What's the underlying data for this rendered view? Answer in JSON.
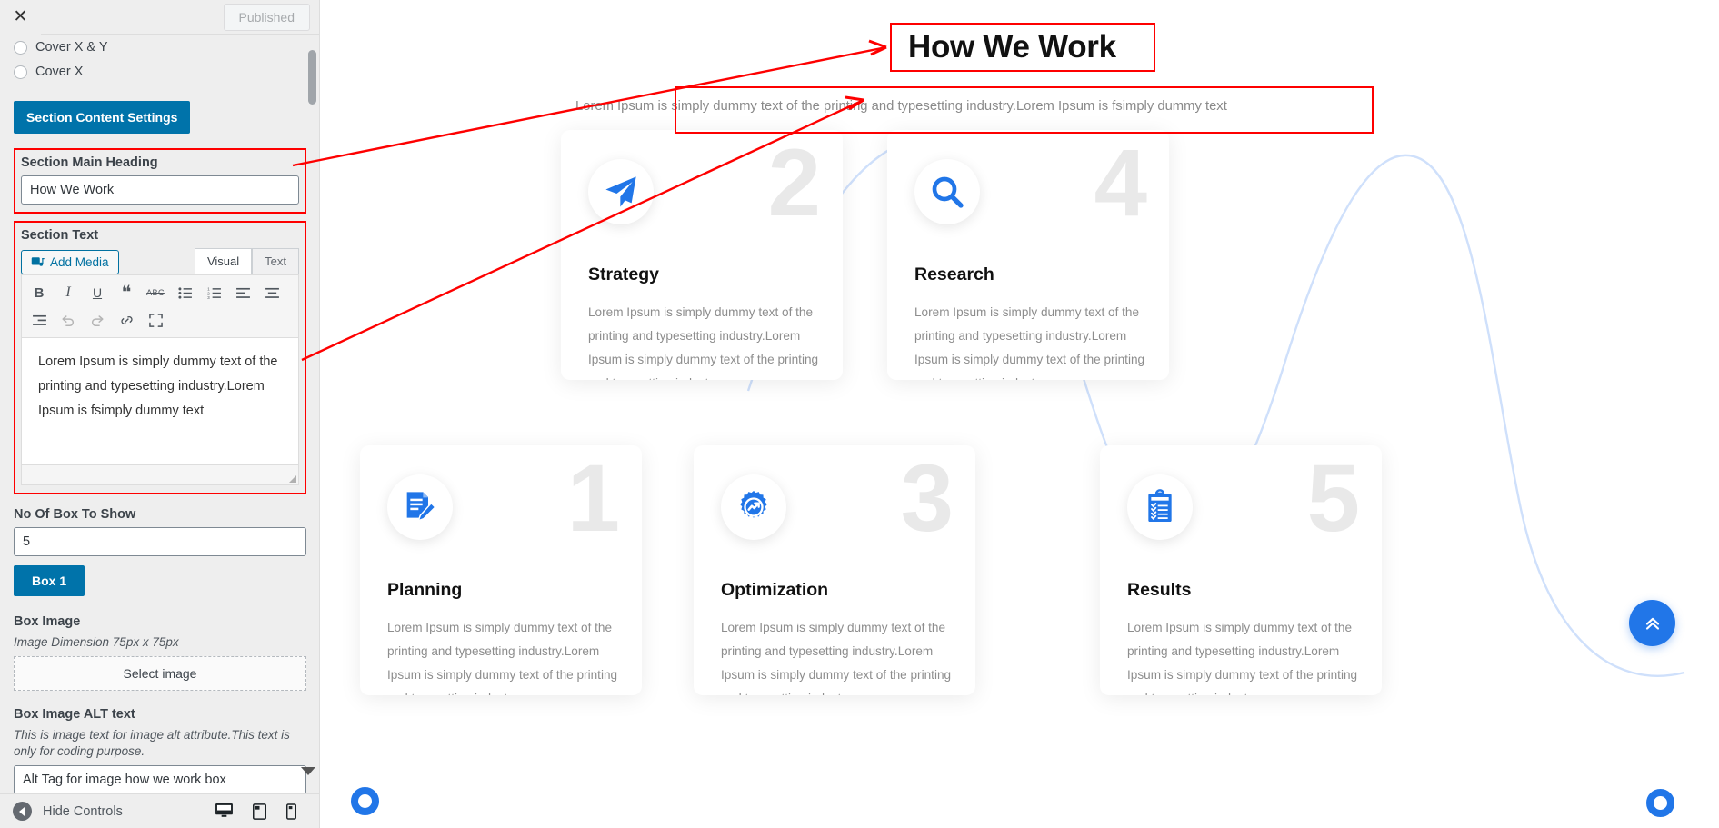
{
  "customizer": {
    "close_icon": "close-x-icon",
    "publish_label": "Published",
    "radio_options": [
      {
        "label": "Cover X & Y"
      },
      {
        "label": "Cover X"
      }
    ],
    "section_content_settings_label": "Section Content Settings",
    "main_heading": {
      "label": "Section Main Heading",
      "value": "How We Work"
    },
    "section_text": {
      "label": "Section Text",
      "add_media_label": "Add Media",
      "tabs": [
        {
          "label": "Visual",
          "active": true
        },
        {
          "label": "Text",
          "active": false
        }
      ],
      "toolbar_row1": [
        {
          "name": "bold-icon",
          "glyph": "B"
        },
        {
          "name": "italic-icon",
          "glyph": "I"
        },
        {
          "name": "underline-icon",
          "glyph": "U"
        },
        {
          "name": "blockquote-icon",
          "glyph": "“"
        },
        {
          "name": "strikethrough-icon",
          "glyph": "ABC"
        },
        {
          "name": "bulleted-list-icon",
          "glyph": "list"
        },
        {
          "name": "numbered-list-icon",
          "glyph": "numlist"
        },
        {
          "name": "align-left-icon",
          "glyph": "alignleft"
        },
        {
          "name": "align-center-icon",
          "glyph": "aligncenter"
        }
      ],
      "toolbar_row2": [
        {
          "name": "align-right-icon",
          "glyph": "alignright"
        },
        {
          "name": "undo-icon",
          "glyph": "↶"
        },
        {
          "name": "redo-icon",
          "glyph": "↷"
        },
        {
          "name": "insert-link-icon",
          "glyph": "link"
        },
        {
          "name": "fullscreen-icon",
          "glyph": "fullscreen"
        }
      ],
      "content": "Lorem Ipsum is simply dummy text of the printing and typesetting industry.Lorem Ipsum is fsimply dummy text"
    },
    "no_of_box": {
      "label": "No Of Box To Show",
      "value": "5"
    },
    "box_tab_label": "Box 1",
    "box_image": {
      "label": "Box Image",
      "help": "Image Dimension 75px x 75px",
      "select_label": "Select image"
    },
    "box_image_alt": {
      "label": "Box Image ALT text",
      "help": "This is image text for image alt attribute.This text is only for coding purpose.",
      "value": "Alt Tag for image how we work box"
    },
    "footer": {
      "collapse_label": "Hide Controls",
      "devices": [
        {
          "name": "desktop-preview-icon"
        },
        {
          "name": "tablet-preview-icon"
        },
        {
          "name": "mobile-preview-icon"
        }
      ]
    }
  },
  "preview": {
    "heading": "How We Work",
    "subtext": "Lorem Ipsum is simply dummy text of the printing and typesetting industry.Lorem Ipsum is fsimply dummy text",
    "body_text": "Lorem Ipsum is simply dummy text of the printing and typesetting industry.Lorem Ipsum is simply dummy text of the printing and typesetting industry.",
    "accent_color": "#2176e8",
    "watermark_color": "#e9e9e9",
    "cards": [
      {
        "number": "2",
        "title": "Strategy",
        "icon": "paper-plane-icon"
      },
      {
        "number": "4",
        "title": "Research",
        "icon": "magnifier-icon"
      },
      {
        "number": "1",
        "title": "Planning",
        "icon": "document-pencil-icon"
      },
      {
        "number": "3",
        "title": "Optimization",
        "icon": "gear-trend-icon"
      },
      {
        "number": "5",
        "title": "Results",
        "icon": "clipboard-check-icon"
      }
    ],
    "scroll_top_icon": "double-chevron-up-icon"
  },
  "annotations": {
    "color": "#fe0000"
  }
}
